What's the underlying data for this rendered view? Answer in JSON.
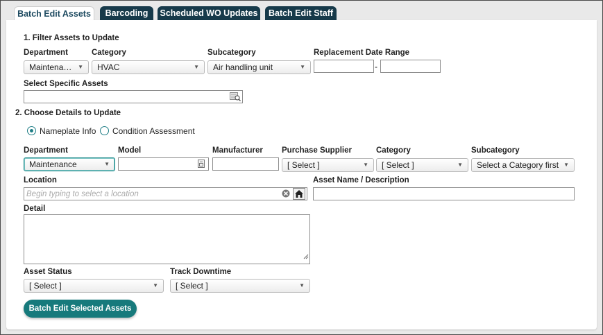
{
  "tabs": [
    {
      "label": "Batch Edit Assets"
    },
    {
      "label": "Barcoding"
    },
    {
      "label": "Scheduled WO Updates"
    },
    {
      "label": "Batch Edit Staff"
    }
  ],
  "section1": {
    "title": "1. Filter Assets to Update",
    "department": {
      "label": "Department",
      "value": "Maintena…"
    },
    "category": {
      "label": "Category",
      "value": "HVAC"
    },
    "subcategory": {
      "label": "Subcategory",
      "value": "Air handling unit"
    },
    "replacement": {
      "label": "Replacement Date Range",
      "separator": "-",
      "from": "",
      "to": ""
    },
    "specific_assets": {
      "label": "Select Specific Assets",
      "value": ""
    }
  },
  "section2": {
    "title": "2. Choose Details to Update",
    "radio_nameplate": "Nameplate Info",
    "radio_condition": "Condition Assessment",
    "department": {
      "label": "Department",
      "value": "Maintenance"
    },
    "model": {
      "label": "Model",
      "value": ""
    },
    "manufacturer": {
      "label": "Manufacturer",
      "value": ""
    },
    "purchase_supplier": {
      "label": "Purchase Supplier",
      "value": "[ Select ]"
    },
    "category": {
      "label": "Category",
      "value": "[ Select ]"
    },
    "subcategory": {
      "label": "Subcategory",
      "value": "Select a Category first"
    },
    "location": {
      "label": "Location",
      "placeholder": "Begin typing to select a location"
    },
    "asset_name": {
      "label": "Asset Name / Description",
      "value": ""
    },
    "detail": {
      "label": "Detail",
      "value": ""
    },
    "asset_status": {
      "label": "Asset Status",
      "value": "[ Select ]"
    },
    "track_downtime": {
      "label": "Track Downtime",
      "value": "[ Select ]"
    },
    "submit": "Batch Edit Selected Assets"
  },
  "icons": {
    "dropdown": "chevron-down-icon",
    "lookup": "lookup-list-icon",
    "model_picker": "small-list-icon",
    "clear": "clear-circle-icon",
    "home": "home-icon"
  },
  "colors": {
    "tab_bg": "#173a4a",
    "accent": "#177a7c"
  }
}
